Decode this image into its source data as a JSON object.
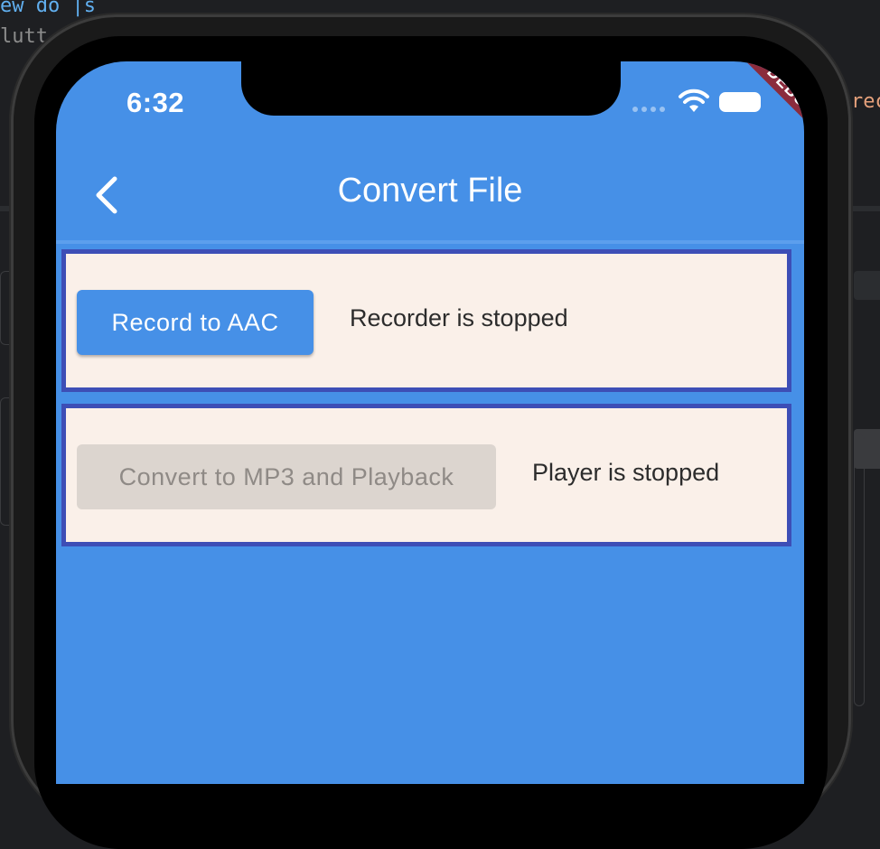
{
  "background": {
    "code_line_1": "ew do |s",
    "code_line_2": "lutt",
    "code_fragment_right": "rec"
  },
  "status_bar": {
    "time": "6:32",
    "debug_banner": "DEBUG"
  },
  "app_bar": {
    "title": "Convert File",
    "back_icon": "chevron-left-icon"
  },
  "recorder_card": {
    "button_label": "Record to AAC",
    "status": "Recorder is stopped"
  },
  "player_card": {
    "button_label": "Convert to MP3 and Playback",
    "button_enabled": false,
    "status": "Player is stopped"
  },
  "colors": {
    "primary": "#4690e7",
    "card_background": "#faf0e9",
    "card_border": "#3d4eb6",
    "disabled_button": "#dcd5cf",
    "debug_banner": "#8b2c3d"
  }
}
